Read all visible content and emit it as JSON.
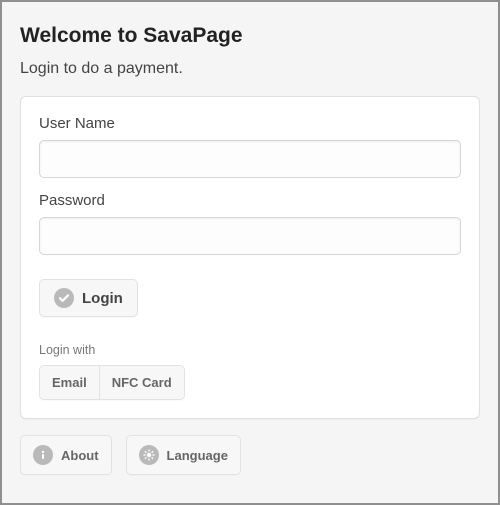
{
  "header": {
    "title": "Welcome to SavaPage",
    "subtitle": "Login to do a payment."
  },
  "form": {
    "username_label": "User Name",
    "username_value": "",
    "password_label": "Password",
    "password_value": "",
    "login_button": "Login",
    "login_with_label": "Login with",
    "options": {
      "email": "Email",
      "nfc": "NFC Card"
    }
  },
  "footer": {
    "about": "About",
    "language": "Language"
  },
  "icons": {
    "check": "check-icon",
    "info": "info-icon",
    "gear": "gear-icon"
  }
}
